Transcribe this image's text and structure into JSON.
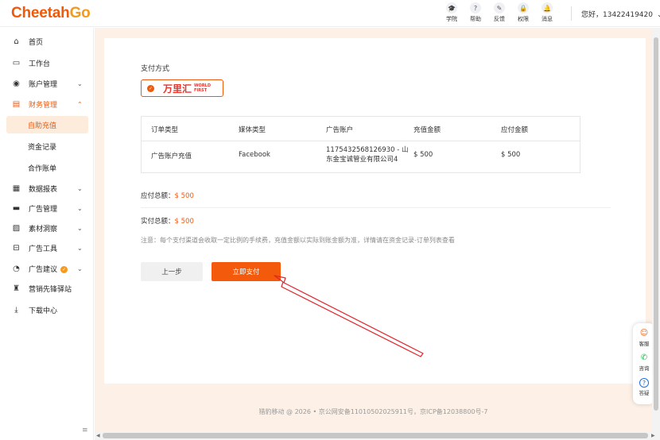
{
  "brand": {
    "part1": "Cheetah",
    "part2": "Go",
    "color1": "#ee5a0c",
    "color2": "#f39a1f"
  },
  "header": {
    "nav": [
      {
        "icon": "graduation-cap-icon",
        "glyph": "🎓",
        "label": "学院"
      },
      {
        "icon": "help-book-icon",
        "glyph": "?",
        "label": "帮助"
      },
      {
        "icon": "feedback-pen-icon",
        "glyph": "✎",
        "label": "反馈"
      },
      {
        "icon": "lock-icon",
        "glyph": "🔒",
        "label": "权限"
      },
      {
        "icon": "bell-icon",
        "glyph": "🔔",
        "label": "消息"
      }
    ],
    "user_greeting": "您好，13422419420",
    "user_caret": "⌄"
  },
  "sidebar": {
    "items": [
      {
        "icon": "home-icon",
        "glyph": "⌂",
        "label": "首页"
      },
      {
        "icon": "monitor-icon",
        "glyph": "▭",
        "label": "工作台"
      },
      {
        "icon": "account-icon",
        "glyph": "◉",
        "label": "账户管理",
        "chevron": "⌄"
      },
      {
        "icon": "finance-icon",
        "glyph": "▤",
        "label": "财务管理",
        "chevron": "⌃"
      },
      {
        "icon": "report-icon",
        "glyph": "▦",
        "label": "数据报表",
        "chevron": "⌄"
      },
      {
        "icon": "ads-icon",
        "glyph": "▬",
        "label": "广告管理",
        "chevron": "⌄"
      },
      {
        "icon": "image-icon",
        "glyph": "▨",
        "label": "素材洞察",
        "chevron": "⌄"
      },
      {
        "icon": "tools-icon",
        "glyph": "⊟",
        "label": "广告工具",
        "chevron": "⌄"
      },
      {
        "icon": "suggest-icon",
        "glyph": "◔",
        "label": "广告建议",
        "chevron": "⌄",
        "badge": "✓"
      },
      {
        "icon": "station-icon",
        "glyph": "♜",
        "label": "营销先锋驿站"
      },
      {
        "icon": "download-icon",
        "glyph": "⤓",
        "label": "下载中心"
      }
    ],
    "finance_sub": [
      {
        "label": "自助充值",
        "selected": true
      },
      {
        "label": "资金记录",
        "selected": false
      },
      {
        "label": "合作账单",
        "selected": false
      }
    ],
    "collapse_glyph": "≡"
  },
  "payment": {
    "section_title": "支付方式",
    "method_name": "万里汇",
    "method_en_1": "WORLD",
    "method_en_2": "FIRST",
    "check_glyph": "✓"
  },
  "table": {
    "headers": [
      "订单类型",
      "媒体类型",
      "广告账户",
      "充值金额",
      "应付金额"
    ],
    "row": [
      "广告账户充值",
      "Facebook",
      "1175432568126930 - 山东金宝诚管业有限公司4",
      "$ 500",
      "$ 500"
    ]
  },
  "summary": {
    "payable_label": "应付总额：",
    "payable_value": "$ 500",
    "actual_label": "实付总额：",
    "actual_value": "$ 500",
    "note": "注意：每个支付渠道会收取一定比例的手续费，充值金额以实际到账金额为准，详情请在资金记录-订单列表查看"
  },
  "buttons": {
    "prev": "上一步",
    "pay": "立即支付"
  },
  "footer": "猎豹移动 @ 2026 • 京公网安备11010502025911号，京ICP备12038800号-7",
  "widget": [
    {
      "icon": "robot-service-icon",
      "glyph": "☺",
      "label": "客服",
      "color": "#ee5a0c"
    },
    {
      "icon": "wechat-icon",
      "glyph": "✆",
      "label": "咨询",
      "color": "#21b34a"
    },
    {
      "icon": "question-icon",
      "glyph": "?",
      "label": "答疑",
      "color": "#1e6fe0"
    }
  ],
  "colors": {
    "accent": "#ee5a0c",
    "annotation_arrow": "#e0252b",
    "main_bg": "#fdf1e7"
  }
}
